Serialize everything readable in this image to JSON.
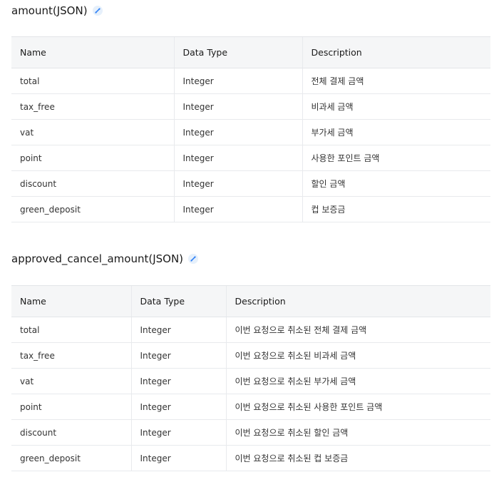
{
  "sections": [
    {
      "title": "amount(JSON)",
      "headers": [
        "Name",
        "Data Type",
        "Description"
      ],
      "rows": [
        {
          "name": "total",
          "type": "Integer",
          "description": "전체 결제 금액"
        },
        {
          "name": "tax_free",
          "type": "Integer",
          "description": "비과세 금액"
        },
        {
          "name": "vat",
          "type": "Integer",
          "description": "부가세 금액"
        },
        {
          "name": "point",
          "type": "Integer",
          "description": "사용한 포인트 금액"
        },
        {
          "name": "discount",
          "type": "Integer",
          "description": "할인 금액"
        },
        {
          "name": "green_deposit",
          "type": "Integer",
          "description": "컵 보증금"
        }
      ]
    },
    {
      "title": "approved_cancel_amount(JSON)",
      "headers": [
        "Name",
        "Data Type",
        "Description"
      ],
      "rows": [
        {
          "name": "total",
          "type": "Integer",
          "description": "이번 요청으로 취소된 전체 결제 금액"
        },
        {
          "name": "tax_free",
          "type": "Integer",
          "description": "이번 요청으로 취소된 비과세 금액"
        },
        {
          "name": "vat",
          "type": "Integer",
          "description": "이번 요청으로 취소된 부가세 금액"
        },
        {
          "name": "point",
          "type": "Integer",
          "description": "이번 요청으로 취소된 사용한 포인트 금액"
        },
        {
          "name": "discount",
          "type": "Integer",
          "description": "이번 요청으로 취소된 할인 금액"
        },
        {
          "name": "green_deposit",
          "type": "Integer",
          "description": "이번 요청으로 취소된 컵 보증금"
        }
      ]
    }
  ],
  "icons": {
    "anchor": "link-icon"
  },
  "colors": {
    "header_bg": "#f5f6f7",
    "border": "#e8eaed",
    "anchor_icon_bg": "#e6f0fb",
    "anchor_icon_fg": "#3182f6"
  }
}
